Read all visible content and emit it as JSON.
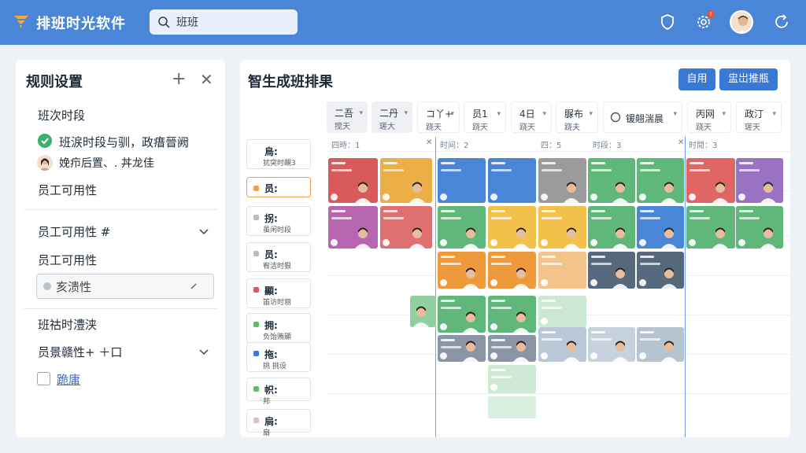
{
  "app": {
    "title": "排班时光软件"
  },
  "search": {
    "value": "班班"
  },
  "colors": {
    "topbar": "#4a86d8",
    "primary": "#3a78d6",
    "success": "#3bb26b"
  },
  "left": {
    "title": "规则设置",
    "shift_period": "班次时段",
    "check_text": "班涙时段与驯，政瘄晉阙",
    "avatar_text": "娩疖后置、. 丼龙佳",
    "availability": "员工可用性",
    "availability_hash": "员工可用性 #",
    "availability2": "员工可用性",
    "field_value": "亥溃性",
    "shift_time": "班祜时澧浃",
    "member_more": "员景赣性+ ＋口",
    "link_text": "跪庸"
  },
  "main": {
    "title": "智生成班排果",
    "btn_apply": "自用",
    "btn_export": "盅岀推瓶",
    "toolbar": [
      {
        "l1": "二吾",
        "l2": "搅天"
      },
      {
        "l1": "二丹",
        "l2": "瑳大"
      },
      {
        "l1": "コ丫+",
        "l2": "跷天"
      },
      {
        "l1": "员1",
        "l2": "跷天"
      },
      {
        "l1": "4日",
        "l2": "跷天"
      },
      {
        "l1": "脲布",
        "l2": "跷夫"
      },
      {
        "l1": "锾翹湍晨",
        "l2": ""
      },
      {
        "l1": "丙网",
        "l2": "跷天"
      },
      {
        "l1": "政汀",
        "l2": "瑳天"
      }
    ],
    "roster": [
      {
        "r1": "烏:",
        "r2": "犹突时靦3"
      },
      {
        "r1": "员:",
        "r2": ""
      },
      {
        "r1": "拐:",
        "r2": "虽闲时段"
      },
      {
        "r1": "员:",
        "r2": "宥洁时狠"
      },
      {
        "r1": "顯:",
        "r2": "笛访时丽"
      },
      {
        "r1": "拥:",
        "r2": "负饴贿顯"
      },
      {
        "r1": "拖:",
        "r2": "挑 挑设"
      },
      {
        "r1": "帜:",
        "r2": "邦"
      },
      {
        "r1": "扃:",
        "r2": "扇"
      }
    ],
    "columns": [
      {
        "label": "四時：1"
      },
      {
        "label": "时间：2"
      },
      {
        "label": "四：5"
      },
      {
        "label": "时段：3"
      },
      {
        "label": "时閒：3"
      }
    ]
  }
}
